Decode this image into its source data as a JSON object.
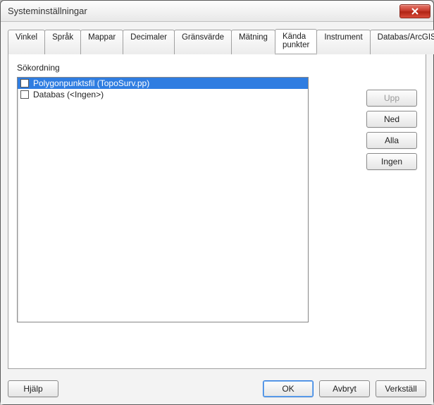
{
  "window": {
    "title": "Systeminställningar"
  },
  "tabs": [
    {
      "label": "Vinkel",
      "active": false
    },
    {
      "label": "Språk",
      "active": false
    },
    {
      "label": "Mappar",
      "active": false
    },
    {
      "label": "Decimaler",
      "active": false
    },
    {
      "label": "Gränsvärde",
      "active": false
    },
    {
      "label": "Mätning",
      "active": false
    },
    {
      "label": "Kända punkter",
      "active": true
    },
    {
      "label": "Instrument",
      "active": false
    },
    {
      "label": "Databas/ArcGIS",
      "active": false
    }
  ],
  "section": {
    "label": "Sökordning"
  },
  "items": [
    {
      "label": "Polygonpunktsfil (TopoSurv.pp)",
      "checked": false,
      "selected": true
    },
    {
      "label": "Databas (<Ingen>)",
      "checked": false,
      "selected": false
    }
  ],
  "side_buttons": {
    "up": {
      "label": "Upp",
      "enabled": false
    },
    "down": {
      "label": "Ned",
      "enabled": true
    },
    "all": {
      "label": "Alla",
      "enabled": true
    },
    "none": {
      "label": "Ingen",
      "enabled": true
    }
  },
  "bottom": {
    "help": "Hjälp",
    "ok": "OK",
    "cancel": "Avbryt",
    "apply": "Verkställ"
  }
}
